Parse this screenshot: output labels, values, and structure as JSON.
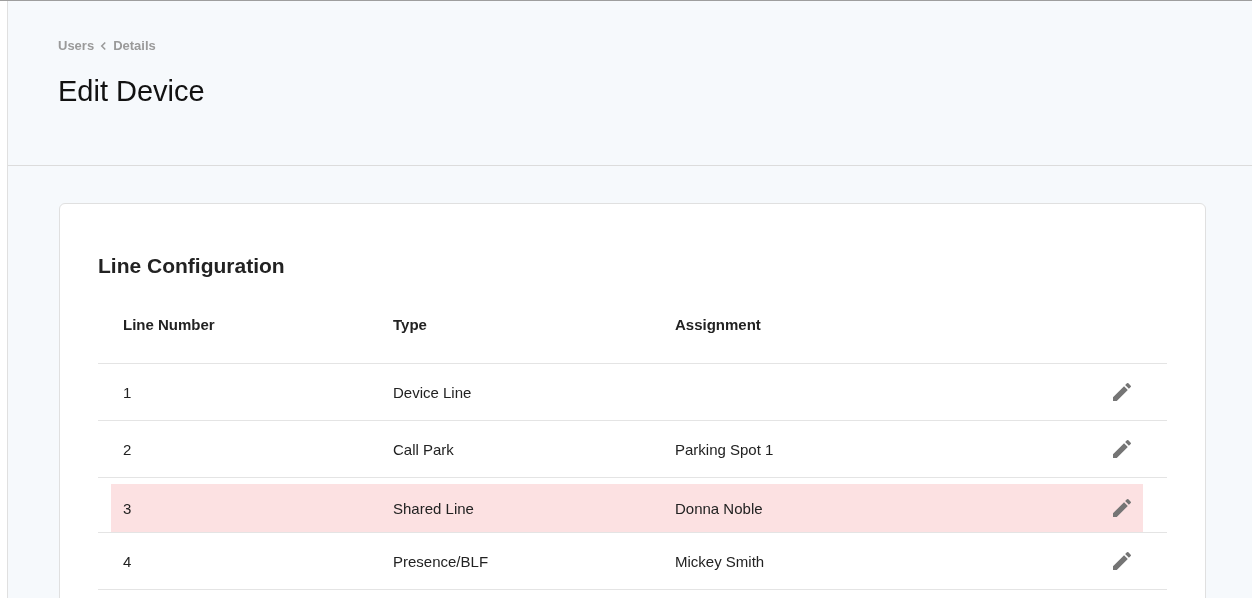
{
  "breadcrumb": {
    "parent": "Users",
    "current": "Details"
  },
  "page_title": "Edit Device",
  "card": {
    "title": "Line Configuration",
    "table": {
      "columns": [
        "Line Number",
        "Type",
        "Assignment"
      ],
      "rows": [
        {
          "line_number": "1",
          "type": "Device Line",
          "assignment": "",
          "highlighted": false
        },
        {
          "line_number": "2",
          "type": "Call Park",
          "assignment": "Parking Spot 1",
          "highlighted": false
        },
        {
          "line_number": "3",
          "type": "Shared Line",
          "assignment": "Donna Noble",
          "highlighted": true
        },
        {
          "line_number": "4",
          "type": "Presence/BLF",
          "assignment": "Mickey Smith",
          "highlighted": false
        }
      ]
    }
  }
}
